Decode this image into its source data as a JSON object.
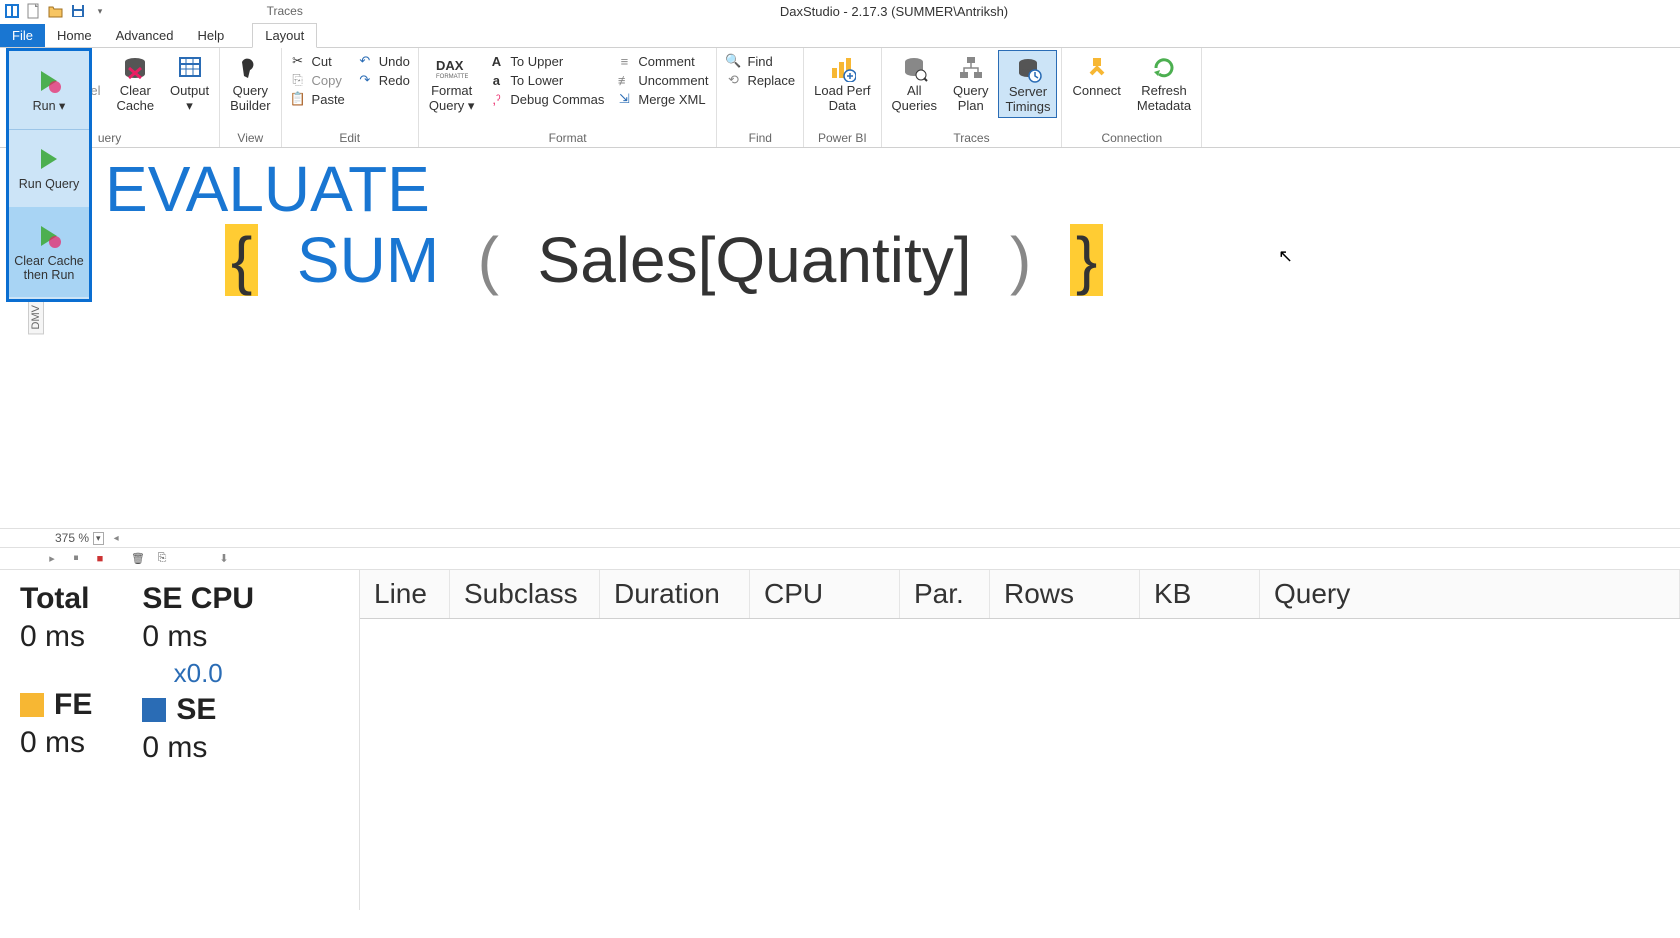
{
  "title": "DaxStudio - 2.17.3 (SUMMER\\Antriksh)",
  "menu": {
    "file": "File",
    "home": "Home",
    "advanced": "Advanced",
    "help": "Help",
    "traces_context": "Traces",
    "layout": "Layout"
  },
  "ribbon": {
    "query": {
      "label": "uery",
      "run": "Run ▾",
      "cancel": "Cancel",
      "clear_cache": "Clear\nCache",
      "output": "Output\n▾",
      "builder": "Query\nBuilder"
    },
    "view": {
      "label": "View"
    },
    "edit": {
      "label": "Edit",
      "cut": "Cut",
      "copy": "Copy",
      "paste": "Paste",
      "undo": "Undo",
      "redo": "Redo"
    },
    "format": {
      "label": "Format",
      "format_query": "Format\nQuery ▾",
      "to_upper": "To Upper",
      "to_lower": "To Lower",
      "debug_commas": "Debug Commas",
      "comment": "Comment",
      "uncomment": "Uncomment",
      "merge_xml": "Merge XML"
    },
    "find": {
      "label": "Find",
      "find": "Find",
      "replace": "Replace"
    },
    "powerbi": {
      "label": "Power BI",
      "load_perf": "Load Perf\nData"
    },
    "traces": {
      "label": "Traces",
      "all_queries": "All\nQueries",
      "query_plan": "Query\nPlan",
      "server_timings": "Server\nTimings"
    },
    "connection": {
      "label": "Connection",
      "connect": "Connect",
      "refresh": "Refresh\nMetadata"
    }
  },
  "run_dropdown": {
    "run_query": "Run Query",
    "clear_then_run": "Clear Cache\nthen Run"
  },
  "sidebar_tab": "DMV",
  "code": {
    "line1_kw": "EVALUATE",
    "line2_brace_open": "{",
    "line2_func": "SUM",
    "line2_paren_open": "(",
    "line2_ident": "Sales[Quantity]",
    "line2_paren_close": ")",
    "line2_brace_close": "}"
  },
  "zoom": "375 %",
  "stats": {
    "total_label": "Total",
    "total_val": "0 ms",
    "secpu_label": "SE CPU",
    "secpu_val": "0 ms",
    "secpu_mult": "x0.0",
    "fe_label": "FE",
    "fe_val": "0 ms",
    "se_label": "SE",
    "se_val": "0 ms"
  },
  "grid_headers": {
    "line": "Line",
    "subclass": "Subclass",
    "duration": "Duration",
    "cpu": "CPU",
    "par": "Par.",
    "rows": "Rows",
    "kb": "KB",
    "query": "Query"
  }
}
